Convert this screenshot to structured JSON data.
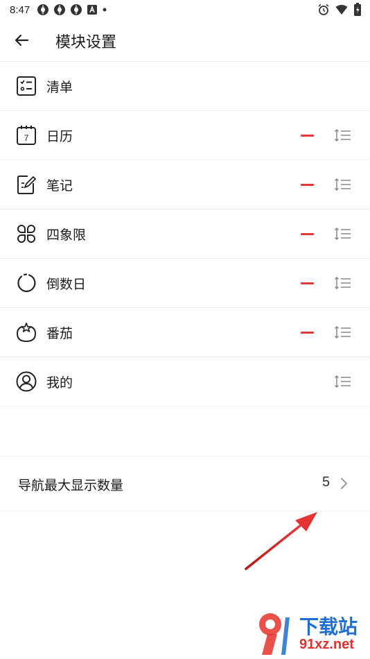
{
  "status_bar": {
    "time": "8:47",
    "notification_icons": [
      "aperture-icon",
      "aperture-icon",
      "aperture-icon",
      "a-icon",
      "dot-icon"
    ],
    "right_icons": [
      "alarm-icon",
      "wifi-icon",
      "battery-icon"
    ]
  },
  "app_bar": {
    "title": "模块设置"
  },
  "modules": [
    {
      "label": "清单",
      "icon": "checklist-icon",
      "removable": false
    },
    {
      "label": "日历",
      "icon": "calendar-icon",
      "calendar_day": "7",
      "removable": true
    },
    {
      "label": "笔记",
      "icon": "note-icon",
      "removable": true
    },
    {
      "label": "四象限",
      "icon": "quadrant-icon",
      "removable": true
    },
    {
      "label": "倒数日",
      "icon": "countdown-icon",
      "removable": true
    },
    {
      "label": "番茄",
      "icon": "tomato-icon",
      "removable": true
    },
    {
      "label": "我的",
      "icon": "profile-icon",
      "removable": false
    }
  ],
  "nav_setting": {
    "label": "导航最大显示数量",
    "value": "5"
  },
  "watermark": {
    "title": "下载站",
    "domain": "91xz.net"
  },
  "colors": {
    "remove": "#e0383b",
    "annotation_arrow": "#d92626",
    "watermark_blue": "#1e6fd1",
    "watermark_red": "#e03030"
  }
}
